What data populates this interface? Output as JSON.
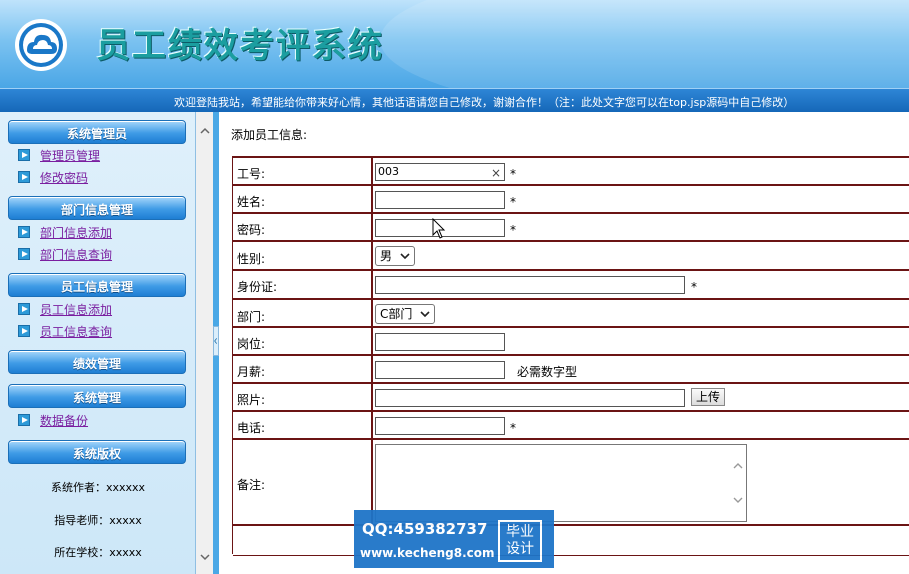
{
  "header": {
    "title": "员工绩效考评系统",
    "marquee": "欢迎登陆我站，希望能给你带来好心情，其他话语请您自己修改，谢谢合作！（注：此处文字您可以在top.jsp源码中自己修改）"
  },
  "sidebar": {
    "groups": [
      {
        "title": "系统管理员",
        "items": [
          "管理员管理",
          "修改密码"
        ]
      },
      {
        "title": "部门信息管理",
        "items": [
          "部门信息添加",
          "部门信息查询"
        ]
      },
      {
        "title": "员工信息管理",
        "items": [
          "员工信息添加",
          "员工信息查询"
        ]
      },
      {
        "title": "绩效管理",
        "items": []
      },
      {
        "title": "系统管理",
        "items": [
          "数据备份"
        ]
      },
      {
        "title": "系统版权",
        "items": []
      }
    ],
    "copyright": [
      "系统作者：xxxxxx",
      "指导老师：xxxxx",
      "所在学校：xxxxx"
    ]
  },
  "content": {
    "heading": "添加员工信息:",
    "form": {
      "employee_id_label": "工号:",
      "employee_id_value": "003",
      "name_label": "姓名:",
      "password_label": "密码:",
      "gender_label": "性别:",
      "gender_value": "男",
      "id_card_label": "身份证:",
      "department_label": "部门:",
      "department_value": "C部门",
      "position_label": "岗位:",
      "salary_label": "月薪:",
      "salary_hint": "必需数字型",
      "photo_label": "照片:",
      "upload_label": "上传",
      "phone_label": "电话:",
      "notes_label": "备注:",
      "required_mark": "*",
      "clear_mark": "×"
    }
  },
  "watermark": {
    "qq": "QQ:459382737",
    "site": "www.kecheng8.com",
    "badge_line1": "毕业",
    "badge_line2": "设计"
  },
  "colors": {
    "header_top": "#bfe3fb",
    "header_bottom": "#4aa6e6",
    "marquee": "#1e74c8",
    "sidebar_bg": "#d6ecfa",
    "link": "#7a1fa0",
    "form_border": "#6b1414"
  }
}
